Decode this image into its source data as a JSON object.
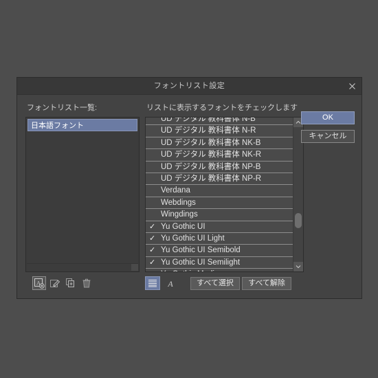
{
  "dialog": {
    "title": "フォントリスト設定",
    "close_icon": "close-icon"
  },
  "left": {
    "label": "フォントリスト一覧:",
    "items": [
      {
        "label": "日本語フォント",
        "selected": true
      }
    ],
    "toolbar": [
      {
        "name": "add-font-list-button",
        "icon": "font-add-icon",
        "active": true
      },
      {
        "name": "edit-font-list-button",
        "icon": "pencil-edit-icon",
        "active": false
      },
      {
        "name": "duplicate-font-list-button",
        "icon": "duplicate-icon",
        "active": false
      },
      {
        "name": "delete-font-list-button",
        "icon": "trash-icon",
        "active": false
      }
    ]
  },
  "right": {
    "hint": "リストに表示するフォントをチェックします",
    "fonts": [
      {
        "name": "UD デジタル 教科書体 N-B",
        "checked": false,
        "clipped": "top"
      },
      {
        "name": "UD デジタル 教科書体 N-R",
        "checked": false
      },
      {
        "name": "UD デジタル 教科書体 NK-B",
        "checked": false
      },
      {
        "name": "UD デジタル 教科書体 NK-R",
        "checked": false
      },
      {
        "name": "UD デジタル 教科書体 NP-B",
        "checked": false
      },
      {
        "name": "UD デジタル 教科書体 NP-R",
        "checked": false
      },
      {
        "name": "Verdana",
        "checked": false
      },
      {
        "name": "Webdings",
        "checked": false
      },
      {
        "name": "Wingdings",
        "checked": false
      },
      {
        "name": "Yu Gothic UI",
        "checked": true
      },
      {
        "name": "Yu Gothic UI Light",
        "checked": true
      },
      {
        "name": "Yu Gothic UI Semibold",
        "checked": true
      },
      {
        "name": "Yu Gothic UI Semilight",
        "checked": true
      },
      {
        "name": "Yu Gothic Medium",
        "checked": false,
        "clipped": "bottom"
      }
    ],
    "check_mark": "✓",
    "scrollbar": {
      "up_icon": "chevron-up-icon",
      "down_icon": "chevron-down-icon",
      "thumb_position_percent": 72
    },
    "view_toggles": [
      {
        "name": "list-view-toggle",
        "icon": "list-lines-icon",
        "active": true
      },
      {
        "name": "font-preview-toggle",
        "icon": "script-a-icon",
        "active": false
      }
    ],
    "select_all_label": "すべて選択",
    "deselect_all_label": "すべて解除"
  },
  "actions": {
    "ok_label": "OK",
    "cancel_label": "キャンセル"
  },
  "colors": {
    "desktop": "#4d4d4d",
    "dialog_bg": "#434343",
    "titlebar": "#383838",
    "accent": "#6b7ba3",
    "row_bg": "#4a4a4a",
    "row_separator": "#8d8d8d",
    "text": "#e2e2e2"
  }
}
